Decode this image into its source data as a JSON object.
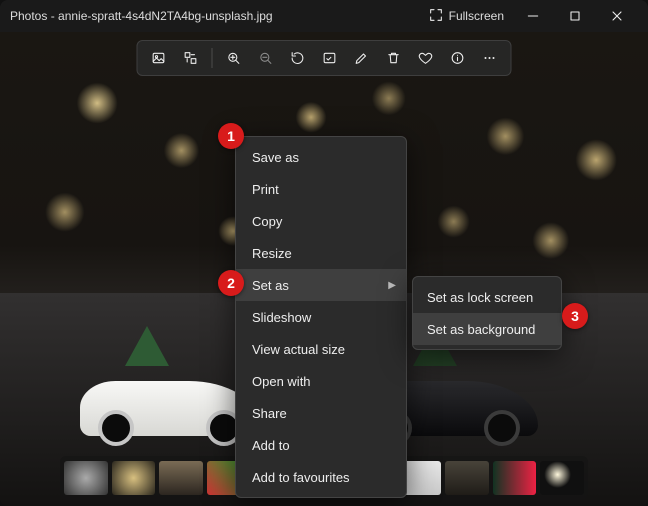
{
  "title": "Photos - annie-spratt-4s4dN2TA4bg-unsplash.jpg",
  "titlebar": {
    "fullscreen": "Fullscreen"
  },
  "callouts": {
    "c1": "1",
    "c2": "2",
    "c3": "3"
  },
  "context_menu": {
    "items": [
      {
        "label": "Save as"
      },
      {
        "label": "Print"
      },
      {
        "label": "Copy"
      },
      {
        "label": "Resize"
      },
      {
        "label": "Set as",
        "submenu": true,
        "highlight": true
      },
      {
        "label": "Slideshow"
      },
      {
        "label": "View actual size"
      },
      {
        "label": "Open with"
      },
      {
        "label": "Share"
      },
      {
        "label": "Add to"
      },
      {
        "label": "Add to favourites"
      }
    ]
  },
  "sub_menu": {
    "items": [
      {
        "label": "Set as lock screen"
      },
      {
        "label": "Set as background",
        "highlight": true
      }
    ]
  },
  "filmstrip": {
    "selected_index": 5,
    "count": 11
  }
}
